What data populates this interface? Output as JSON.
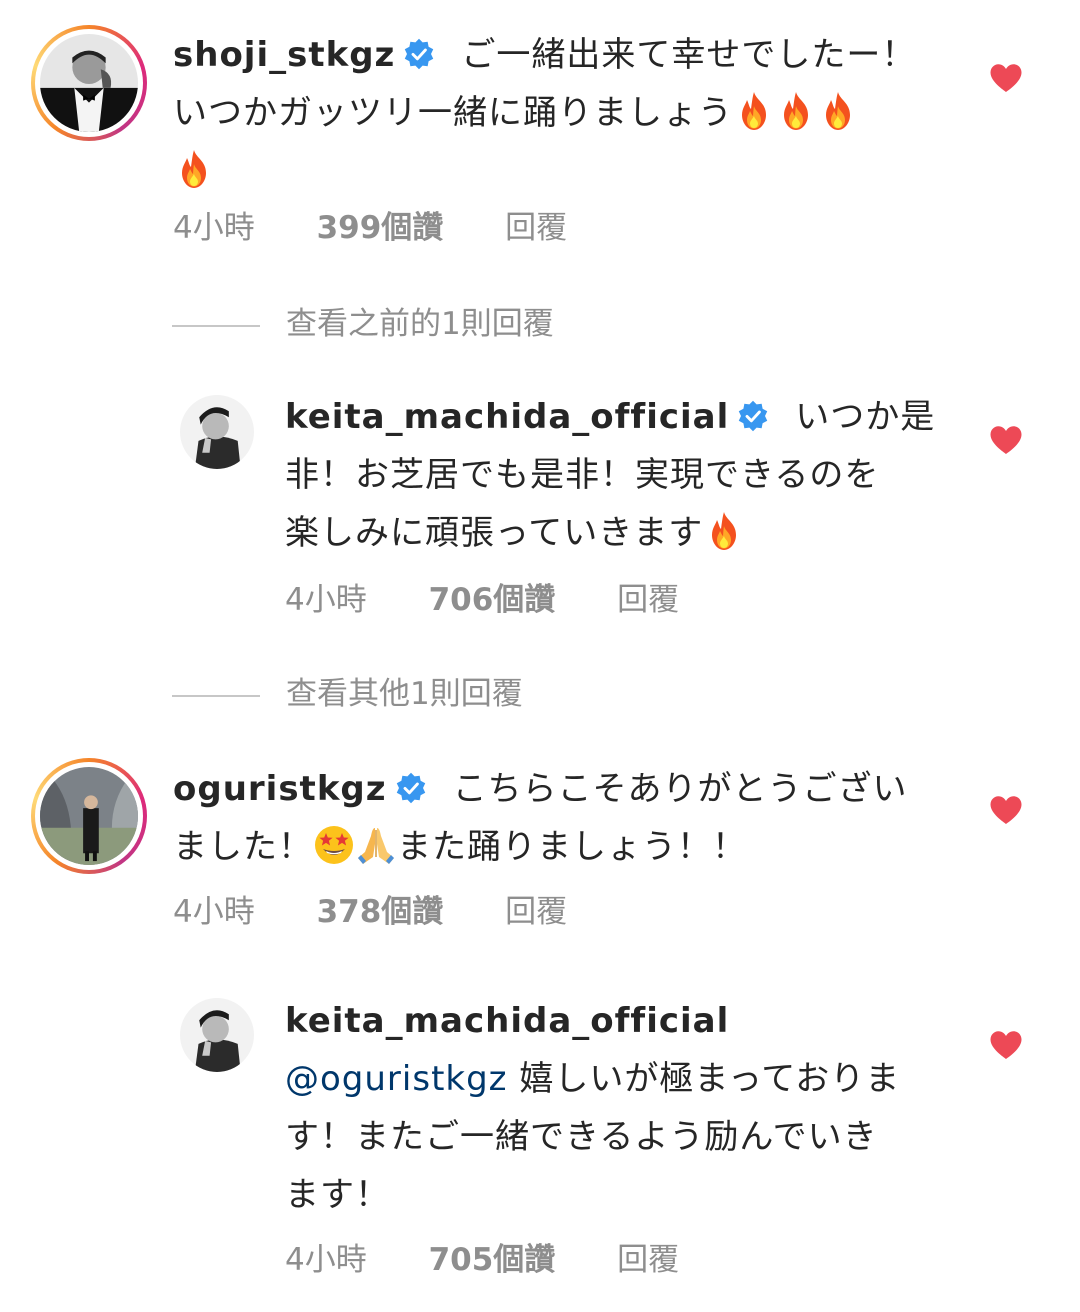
{
  "comments": [
    {
      "username": "shoji_stkgz",
      "text_line1": "ご一緒出来て幸せでしたー！",
      "text_line2": "いつかガッツリ一緒に踊りましょう",
      "time": "4小時",
      "likes": "399個讚",
      "reply": "回覆"
    },
    {
      "view_more": "查看之前的1則回覆"
    },
    {
      "username": "keita_machida_official",
      "text_line1": "いつか是",
      "text_line2": "非！お芝居でも是非！実現できるのを",
      "text_line3": "楽しみに頑張っていきます",
      "time": "4小時",
      "likes": "706個讚",
      "reply": "回覆"
    },
    {
      "view_more": "查看其他1則回覆"
    },
    {
      "username": "oguristkgz",
      "text_line1": "こちらこそありがとうござい",
      "text_line2a": "ました！",
      "text_line2b": "また踊りましょう！！",
      "time": "4小時",
      "likes": "378個讚",
      "reply": "回覆"
    },
    {
      "username": "keita_machida_official",
      "mention": "@oguristkgz",
      "text_line1": " 嬉しいが極まっておりま",
      "text_line2": "す！またご一緒できるよう励んでいき",
      "text_line3": "ます！",
      "time": "4小時",
      "likes": "705個讚",
      "reply": "回覆"
    }
  ],
  "icons": {
    "verified": "verified-badge-icon",
    "heart": "heart-icon",
    "fire": "fire-emoji",
    "star_eyes": "star-struck-emoji",
    "pray": "folded-hands-emoji"
  },
  "colors": {
    "heart": "#ed4956",
    "verified": "#3897f0",
    "mention": "#00376b",
    "meta": "#8e8e8e"
  }
}
